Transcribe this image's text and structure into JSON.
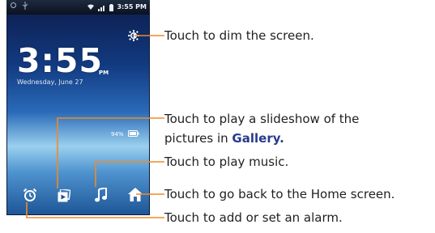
{
  "status_bar": {
    "time": "3:55 PM"
  },
  "lock_screen": {
    "clock": "3:55",
    "ampm": "PM",
    "date": "Wednesday, June 27",
    "battery": "94%"
  },
  "icons": {
    "dim": "brightness-icon",
    "slideshow": "slideshow-icon",
    "music": "music-note-icon",
    "home": "home-icon",
    "alarm": "alarm-clock-icon"
  },
  "callouts": {
    "dim": "Touch to dim the screen.",
    "slideshow_line1": "Touch to play a slideshow of the",
    "slideshow_line2_prefix": "pictures in ",
    "slideshow_line2_bold": "Gallery.",
    "music": "Touch to play music.",
    "home": "Touch to go back to the Home screen.",
    "alarm": "Touch to add or set an alarm."
  },
  "colors": {
    "callout_line": "#f08a24",
    "gallery_emphasis": "#2a3a8c"
  }
}
